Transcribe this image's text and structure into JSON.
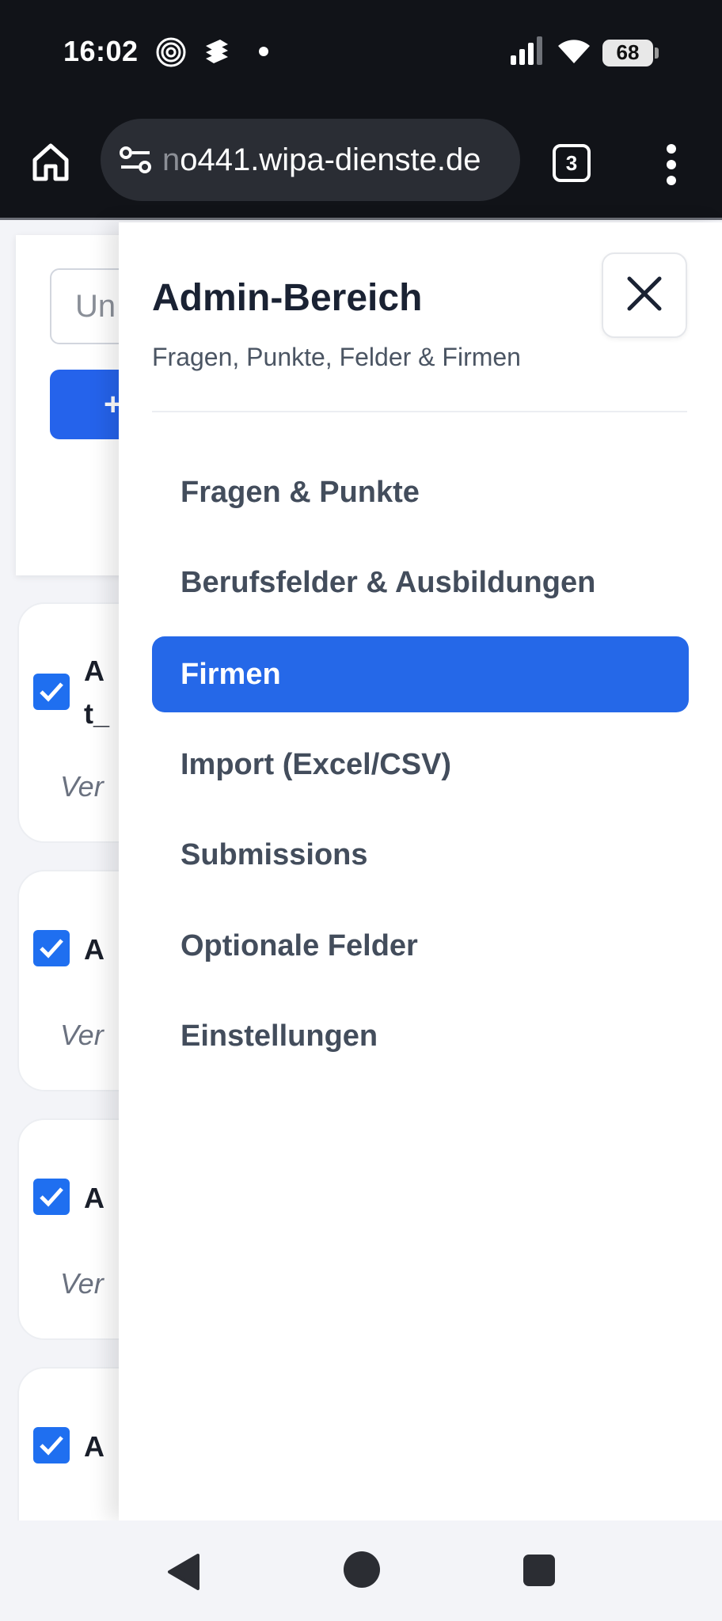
{
  "status_bar": {
    "time": "16:02",
    "battery_level": "68",
    "icons": [
      "fingerprint-icon",
      "app-notification-icon",
      "dot-icon",
      "signal-icon",
      "wifi-icon",
      "battery-icon"
    ]
  },
  "browser": {
    "url_prefix": "n",
    "url_main": "o441.wipa-dienste.de",
    "tab_count": "3"
  },
  "background_page": {
    "search_placeholder": "Un",
    "add_button_label": "+",
    "cards": [
      {
        "checked": true,
        "text_line1": "A",
        "text_line2": "t_",
        "meta": "Ver"
      },
      {
        "checked": true,
        "text_line1": "A",
        "meta": "Ver"
      },
      {
        "checked": true,
        "text_line1": "A",
        "meta": "Ver"
      },
      {
        "checked": true,
        "text_line1": "A"
      }
    ]
  },
  "drawer": {
    "title": "Admin-Bereich",
    "subtitle": "Fragen, Punkte, Felder & Firmen",
    "active_item": "Firmen",
    "items": [
      {
        "label": "Fragen & Punkte"
      },
      {
        "label": "Berufsfelder & Ausbildungen"
      },
      {
        "label": "Firmen"
      },
      {
        "label": "Import (Excel/CSV)"
      },
      {
        "label": "Submissions"
      },
      {
        "label": "Optionale Felder"
      },
      {
        "label": "Einstellungen"
      }
    ]
  },
  "colors": {
    "accent": "#2568e8",
    "dark_bar": "#111318",
    "nav_text": "#434d5c",
    "title_text": "#1a2233"
  }
}
